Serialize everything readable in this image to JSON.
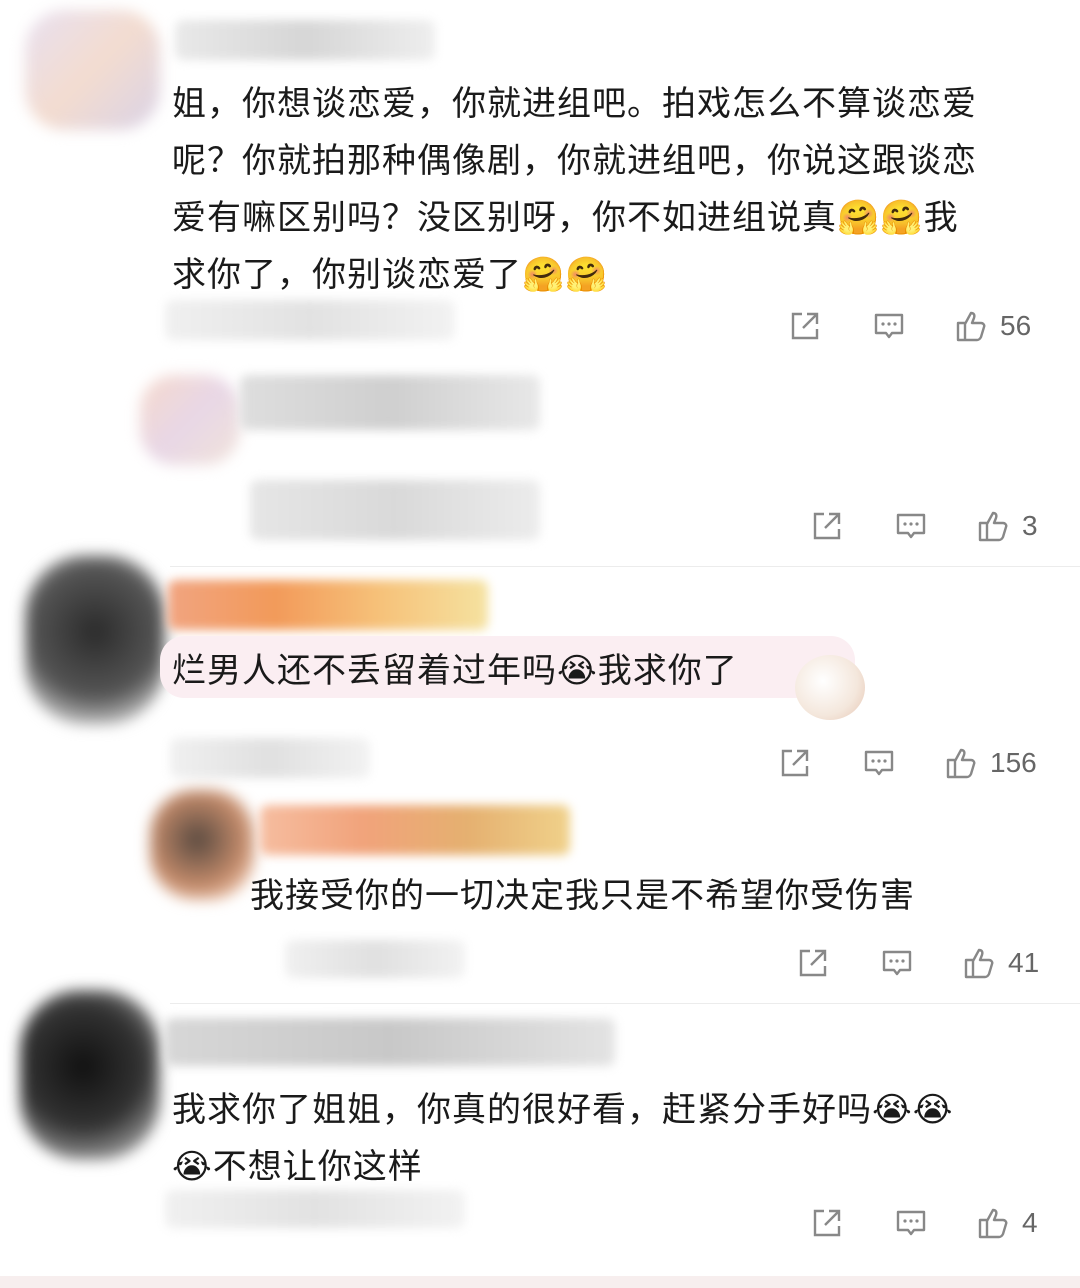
{
  "comments": [
    {
      "text": "姐，你想谈恋爱，你就进组吧。拍戏怎么不算谈恋爱呢？你就拍那种偶像剧，你就进组吧，你说这跟谈恋爱有嘛区别吗？没区别呀，你不如进组说真🤗🤗我求你了，你别谈恋爱了🤗🤗",
      "lines": [
        "姐，你想谈恋爱，你就进组吧。拍戏怎么不算谈恋爱",
        "呢？你就拍那种偶像剧，你就进组吧，你说这跟谈恋",
        "爱有嘛区别吗？没区别呀，你不如进组说真🤗🤗我",
        "求你了，你别谈恋爱了🤗🤗"
      ],
      "likes": "56"
    },
    {
      "likes": "3"
    },
    {
      "text": "烂男人还不丢留着过年吗😭我求你了",
      "likes": "156"
    },
    {
      "text": "我接受你的一切决定我只是不希望你受伤害",
      "likes": "41"
    },
    {
      "lines": [
        "我求你了姐姐，你真的很好看，赶紧分手好吗😭😭",
        "😭不想让你这样"
      ],
      "likes": "4"
    }
  ],
  "icons": {
    "share": "share-icon",
    "comment": "comment-icon",
    "like": "thumbs-up-icon"
  },
  "colors": {
    "text": "#1a1a1a",
    "count": "#666666",
    "bubble": "#fbeef2",
    "icon": "#888888"
  }
}
